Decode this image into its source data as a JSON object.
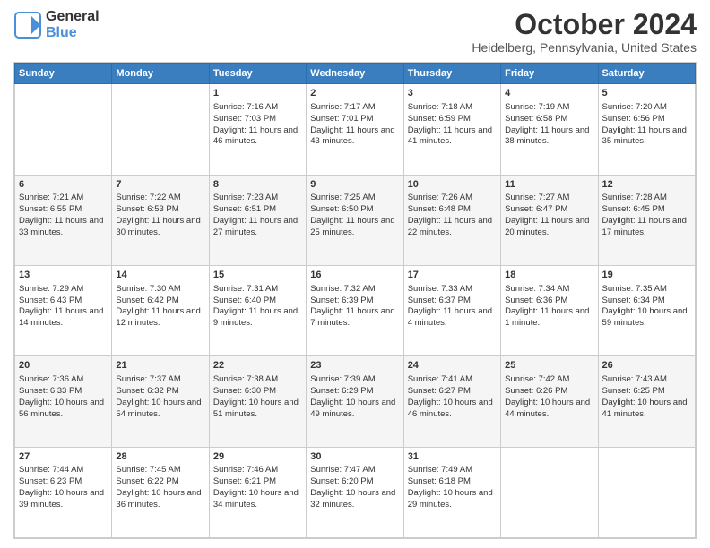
{
  "logo": {
    "line1": "General",
    "line2": "Blue"
  },
  "title": "October 2024",
  "location": "Heidelberg, Pennsylvania, United States",
  "days_of_week": [
    "Sunday",
    "Monday",
    "Tuesday",
    "Wednesday",
    "Thursday",
    "Friday",
    "Saturday"
  ],
  "weeks": [
    [
      {
        "day": "",
        "sunrise": "",
        "sunset": "",
        "daylight": ""
      },
      {
        "day": "",
        "sunrise": "",
        "sunset": "",
        "daylight": ""
      },
      {
        "day": "1",
        "sunrise": "Sunrise: 7:16 AM",
        "sunset": "Sunset: 7:03 PM",
        "daylight": "Daylight: 11 hours and 46 minutes."
      },
      {
        "day": "2",
        "sunrise": "Sunrise: 7:17 AM",
        "sunset": "Sunset: 7:01 PM",
        "daylight": "Daylight: 11 hours and 43 minutes."
      },
      {
        "day": "3",
        "sunrise": "Sunrise: 7:18 AM",
        "sunset": "Sunset: 6:59 PM",
        "daylight": "Daylight: 11 hours and 41 minutes."
      },
      {
        "day": "4",
        "sunrise": "Sunrise: 7:19 AM",
        "sunset": "Sunset: 6:58 PM",
        "daylight": "Daylight: 11 hours and 38 minutes."
      },
      {
        "day": "5",
        "sunrise": "Sunrise: 7:20 AM",
        "sunset": "Sunset: 6:56 PM",
        "daylight": "Daylight: 11 hours and 35 minutes."
      }
    ],
    [
      {
        "day": "6",
        "sunrise": "Sunrise: 7:21 AM",
        "sunset": "Sunset: 6:55 PM",
        "daylight": "Daylight: 11 hours and 33 minutes."
      },
      {
        "day": "7",
        "sunrise": "Sunrise: 7:22 AM",
        "sunset": "Sunset: 6:53 PM",
        "daylight": "Daylight: 11 hours and 30 minutes."
      },
      {
        "day": "8",
        "sunrise": "Sunrise: 7:23 AM",
        "sunset": "Sunset: 6:51 PM",
        "daylight": "Daylight: 11 hours and 27 minutes."
      },
      {
        "day": "9",
        "sunrise": "Sunrise: 7:25 AM",
        "sunset": "Sunset: 6:50 PM",
        "daylight": "Daylight: 11 hours and 25 minutes."
      },
      {
        "day": "10",
        "sunrise": "Sunrise: 7:26 AM",
        "sunset": "Sunset: 6:48 PM",
        "daylight": "Daylight: 11 hours and 22 minutes."
      },
      {
        "day": "11",
        "sunrise": "Sunrise: 7:27 AM",
        "sunset": "Sunset: 6:47 PM",
        "daylight": "Daylight: 11 hours and 20 minutes."
      },
      {
        "day": "12",
        "sunrise": "Sunrise: 7:28 AM",
        "sunset": "Sunset: 6:45 PM",
        "daylight": "Daylight: 11 hours and 17 minutes."
      }
    ],
    [
      {
        "day": "13",
        "sunrise": "Sunrise: 7:29 AM",
        "sunset": "Sunset: 6:43 PM",
        "daylight": "Daylight: 11 hours and 14 minutes."
      },
      {
        "day": "14",
        "sunrise": "Sunrise: 7:30 AM",
        "sunset": "Sunset: 6:42 PM",
        "daylight": "Daylight: 11 hours and 12 minutes."
      },
      {
        "day": "15",
        "sunrise": "Sunrise: 7:31 AM",
        "sunset": "Sunset: 6:40 PM",
        "daylight": "Daylight: 11 hours and 9 minutes."
      },
      {
        "day": "16",
        "sunrise": "Sunrise: 7:32 AM",
        "sunset": "Sunset: 6:39 PM",
        "daylight": "Daylight: 11 hours and 7 minutes."
      },
      {
        "day": "17",
        "sunrise": "Sunrise: 7:33 AM",
        "sunset": "Sunset: 6:37 PM",
        "daylight": "Daylight: 11 hours and 4 minutes."
      },
      {
        "day": "18",
        "sunrise": "Sunrise: 7:34 AM",
        "sunset": "Sunset: 6:36 PM",
        "daylight": "Daylight: 11 hours and 1 minute."
      },
      {
        "day": "19",
        "sunrise": "Sunrise: 7:35 AM",
        "sunset": "Sunset: 6:34 PM",
        "daylight": "Daylight: 10 hours and 59 minutes."
      }
    ],
    [
      {
        "day": "20",
        "sunrise": "Sunrise: 7:36 AM",
        "sunset": "Sunset: 6:33 PM",
        "daylight": "Daylight: 10 hours and 56 minutes."
      },
      {
        "day": "21",
        "sunrise": "Sunrise: 7:37 AM",
        "sunset": "Sunset: 6:32 PM",
        "daylight": "Daylight: 10 hours and 54 minutes."
      },
      {
        "day": "22",
        "sunrise": "Sunrise: 7:38 AM",
        "sunset": "Sunset: 6:30 PM",
        "daylight": "Daylight: 10 hours and 51 minutes."
      },
      {
        "day": "23",
        "sunrise": "Sunrise: 7:39 AM",
        "sunset": "Sunset: 6:29 PM",
        "daylight": "Daylight: 10 hours and 49 minutes."
      },
      {
        "day": "24",
        "sunrise": "Sunrise: 7:41 AM",
        "sunset": "Sunset: 6:27 PM",
        "daylight": "Daylight: 10 hours and 46 minutes."
      },
      {
        "day": "25",
        "sunrise": "Sunrise: 7:42 AM",
        "sunset": "Sunset: 6:26 PM",
        "daylight": "Daylight: 10 hours and 44 minutes."
      },
      {
        "day": "26",
        "sunrise": "Sunrise: 7:43 AM",
        "sunset": "Sunset: 6:25 PM",
        "daylight": "Daylight: 10 hours and 41 minutes."
      }
    ],
    [
      {
        "day": "27",
        "sunrise": "Sunrise: 7:44 AM",
        "sunset": "Sunset: 6:23 PM",
        "daylight": "Daylight: 10 hours and 39 minutes."
      },
      {
        "day": "28",
        "sunrise": "Sunrise: 7:45 AM",
        "sunset": "Sunset: 6:22 PM",
        "daylight": "Daylight: 10 hours and 36 minutes."
      },
      {
        "day": "29",
        "sunrise": "Sunrise: 7:46 AM",
        "sunset": "Sunset: 6:21 PM",
        "daylight": "Daylight: 10 hours and 34 minutes."
      },
      {
        "day": "30",
        "sunrise": "Sunrise: 7:47 AM",
        "sunset": "Sunset: 6:20 PM",
        "daylight": "Daylight: 10 hours and 32 minutes."
      },
      {
        "day": "31",
        "sunrise": "Sunrise: 7:49 AM",
        "sunset": "Sunset: 6:18 PM",
        "daylight": "Daylight: 10 hours and 29 minutes."
      },
      {
        "day": "",
        "sunrise": "",
        "sunset": "",
        "daylight": ""
      },
      {
        "day": "",
        "sunrise": "",
        "sunset": "",
        "daylight": ""
      }
    ]
  ],
  "colors": {
    "header_bg": "#3a7ec0",
    "header_text": "#ffffff",
    "row_shade": "#f5f5f5",
    "row_white": "#ffffff",
    "border": "#cccccc"
  }
}
